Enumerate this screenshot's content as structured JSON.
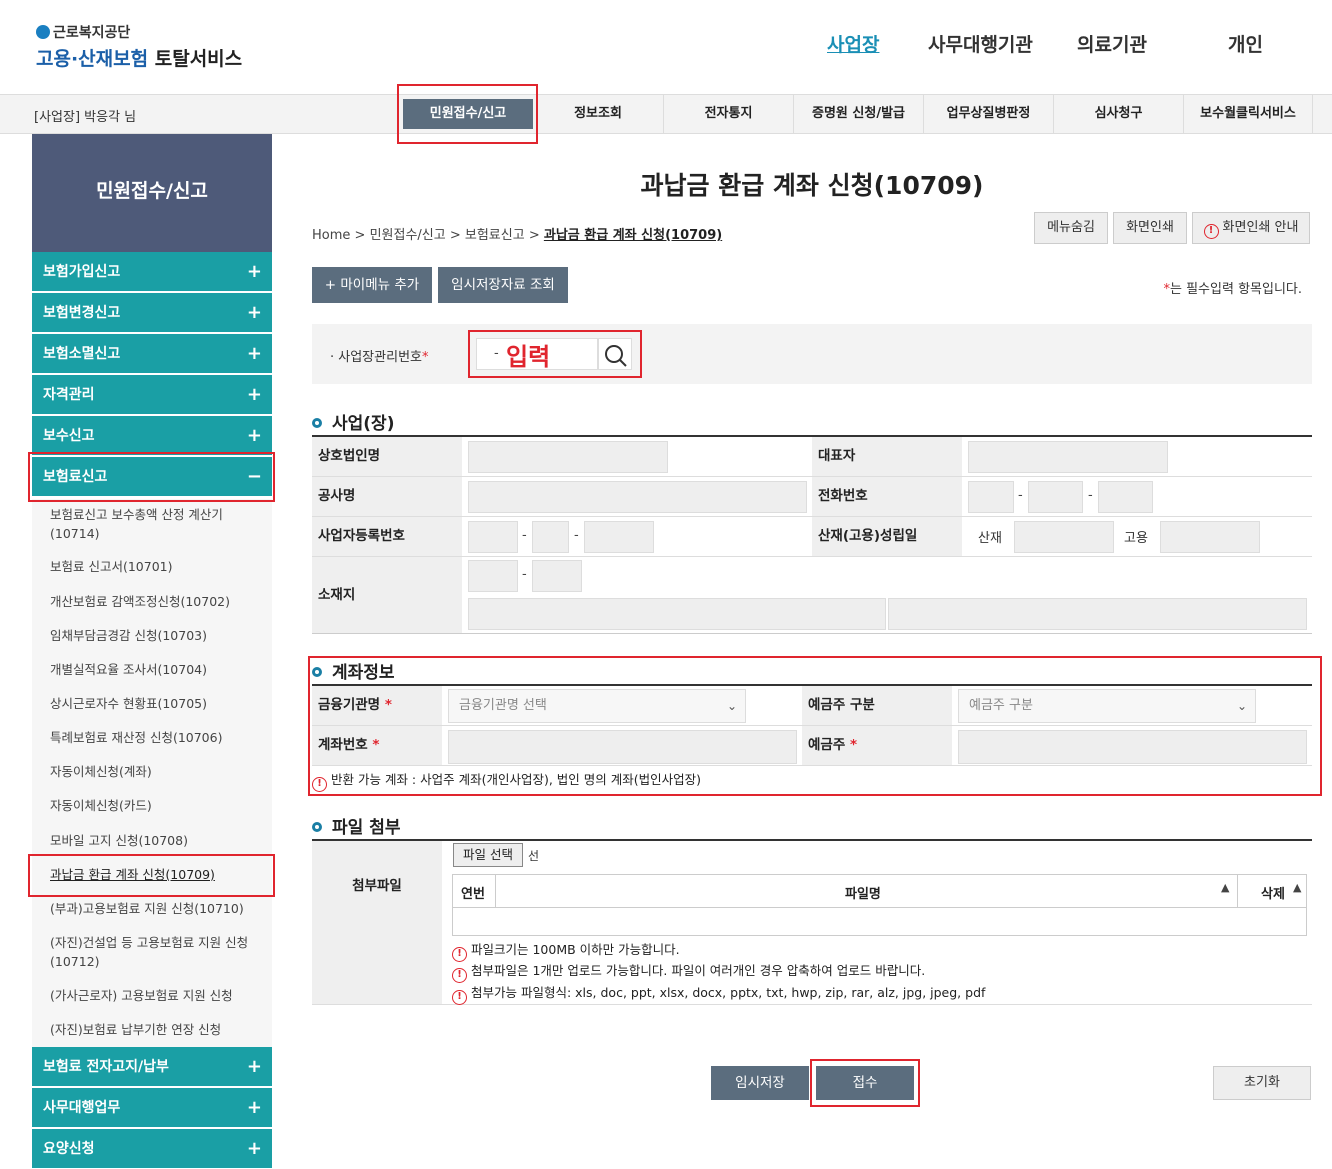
{
  "header": {
    "org": "근로복지공단",
    "service_main": "고용·산재보험",
    "service_sub": "토탈서비스",
    "topnav": [
      "사업장",
      "사무대행기관",
      "의료기관",
      "개인"
    ]
  },
  "gnb": {
    "user": "[사업장] 박응각 님",
    "items": [
      "민원접수/신고",
      "정보조회",
      "전자통지",
      "증명원 신청/발급",
      "업무상질병판정",
      "심사청구",
      "보수월클릭서비스"
    ]
  },
  "lnb": {
    "title": "민원접수/신고",
    "main_top": [
      "보험가입신고",
      "보험변경신고",
      "보험소멸신고",
      "자격관리",
      "보수신고",
      "보험료신고"
    ],
    "subs": [
      "보험료신고 보수총액 산정 계산기",
      "(10714)",
      "보험료 신고서(10701)",
      "개산보험료 감액조정신청(10702)",
      "임채부담금경감 신청(10703)",
      "개별실적요율 조사서(10704)",
      "상시근로자수 현황표(10705)",
      "특례보험료 재산정 신청(10706)",
      "자동이체신청(계좌)",
      "자동이체신청(카드)",
      "모바일 고지 신청(10708)",
      "과납금 환급 계좌 신청(10709)",
      "(부과)고용보험료 지원 신청(10710)",
      "(자진)건설업 등 고용보험료 지원 신청",
      "(10712)",
      "(가사근로자) 고용보험료 지원 신청",
      "(자진)보험료 납부기한 연장 신청"
    ],
    "main_bottom": [
      "보험료 전자고지/납부",
      "사무대행업무",
      "요양신청"
    ]
  },
  "page": {
    "title": "과납금 환급 계좌 신청(10709)",
    "breadcrumb": [
      "Home",
      "민원접수/신고",
      "보험료신고",
      "과납금 환급 계좌 신청(10709)"
    ],
    "btn_hide_menu": "메뉴숨김",
    "btn_print": "화면인쇄",
    "btn_print_guide": "화면인쇄 안내",
    "btn_add_mymenu": "+ 마이메뉴 추가",
    "btn_temp_view": "임시저장자료 조회",
    "required_note": "는 필수입력 항목입니다.",
    "required_mark": "*"
  },
  "search": {
    "label": "· 사업장관리번호",
    "dash": "-",
    "annotation": "입력"
  },
  "business": {
    "title": "사업(장)",
    "labels": {
      "company": "상호법인명",
      "ceo": "대표자",
      "construction": "공사명",
      "phone": "전화번호",
      "regno": "사업자등록번호",
      "establish": "산재(고용)성립일",
      "sanjae": "산재",
      "goyong": "고용",
      "address": "소재지"
    }
  },
  "account": {
    "title": "계좌정보",
    "bank_label": "금융기관명",
    "bank_placeholder": "금융기관명 선택",
    "holder_type_label": "예금주 구분",
    "holder_type_placeholder": "예금주 구분",
    "account_label": "계좌번호",
    "holder_label": "예금주",
    "notice": "반환 가능 계좌 : 사업주 계좌(개인사업장), 법인 명의 계좌(법인사업장)"
  },
  "files": {
    "title": "파일 첨부",
    "label": "첨부파일",
    "choose_button": "파일 선택",
    "choose_status": "선",
    "col_no": "연번",
    "col_name": "파일명",
    "col_delete": "삭제",
    "notices": [
      "파일크기는 100MB 이하만 가능합니다.",
      "첨부파일은 1개만 업로드 가능합니다. 파일이 여러개인 경우 압축하여 업로드 바랍니다.",
      "첨부가능 파일형식: xls, doc, ppt, xlsx, docx, pptx, txt, hwp, zip, rar, alz, jpg, jpeg, pdf"
    ]
  },
  "actions": {
    "temp_save": "임시저장",
    "submit": "접수",
    "reset": "초기화"
  },
  "colors": {
    "teal": "#1a9fa5",
    "navy": "#4e5a79",
    "slate": "#5b6d7e",
    "highlight": "#e0252e"
  }
}
